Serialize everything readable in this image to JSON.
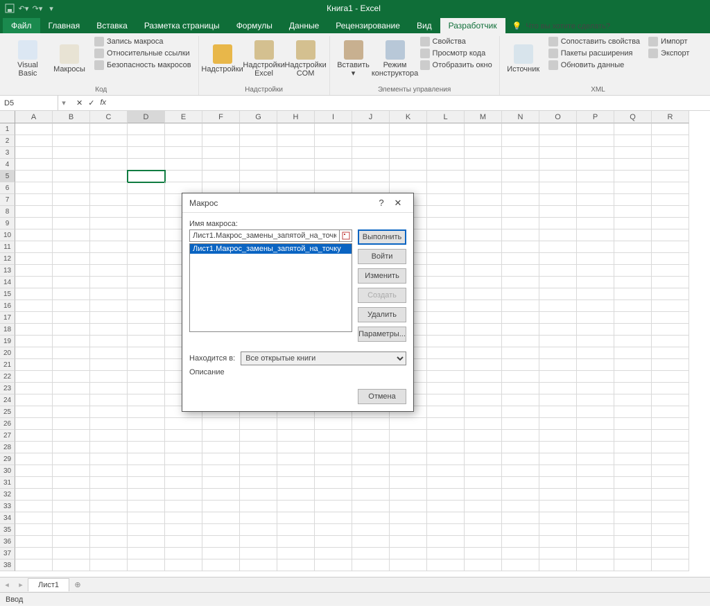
{
  "app_title": "Книга1 - Excel",
  "tabs": {
    "file": "Файл",
    "home": "Главная",
    "insert": "Вставка",
    "layout": "Разметка страницы",
    "formulas": "Формулы",
    "data": "Данные",
    "review": "Рецензирование",
    "view": "Вид",
    "developer": "Разработчик",
    "tell": "Что вы хотите сделать?"
  },
  "ribbon": {
    "code": {
      "vb": "Visual\nBasic",
      "macros": "Макросы",
      "record": "Запись макроса",
      "relref": "Относительные ссылки",
      "security": "Безопасность макросов",
      "label": "Код"
    },
    "addins": {
      "addin": "Надстройки",
      "excel": "Надстройки\nExcel",
      "com": "Надстройки\nCOM",
      "label": "Надстройки"
    },
    "controls": {
      "insert": "Вставить",
      "design": "Режим\nконструктора",
      "props": "Свойства",
      "viewcode": "Просмотр кода",
      "showdlg": "Отобразить окно",
      "label": "Элементы управления"
    },
    "xml": {
      "source": "Источник",
      "map": "Сопоставить свойства",
      "exp": "Пакеты расширения",
      "refresh": "Обновить данные",
      "import": "Импорт",
      "export": "Экспорт",
      "label": "XML"
    }
  },
  "namebox": {
    "ref": "D5"
  },
  "cols": [
    "A",
    "B",
    "C",
    "D",
    "E",
    "F",
    "G",
    "H",
    "I",
    "J",
    "K",
    "L",
    "M",
    "N",
    "O",
    "P",
    "Q",
    "R"
  ],
  "selected": {
    "col": "D",
    "row": 5
  },
  "sheet_tab": "Лист1",
  "status": "Ввод",
  "dialog": {
    "title": "Макрос",
    "name_label": "Имя макроса:",
    "name_value": "Лист1.Макрос_замены_запятой_на_точку",
    "list": [
      "Лист1.Макрос_замены_запятой_на_точку"
    ],
    "btn_run": "Выполнить",
    "btn_step": "Войти",
    "btn_edit": "Изменить",
    "btn_create": "Создать",
    "btn_delete": "Удалить",
    "btn_options": "Параметры...",
    "loc_label": "Находится в:",
    "loc_value": "Все открытые книги",
    "desc_label": "Описание",
    "btn_cancel": "Отмена"
  }
}
